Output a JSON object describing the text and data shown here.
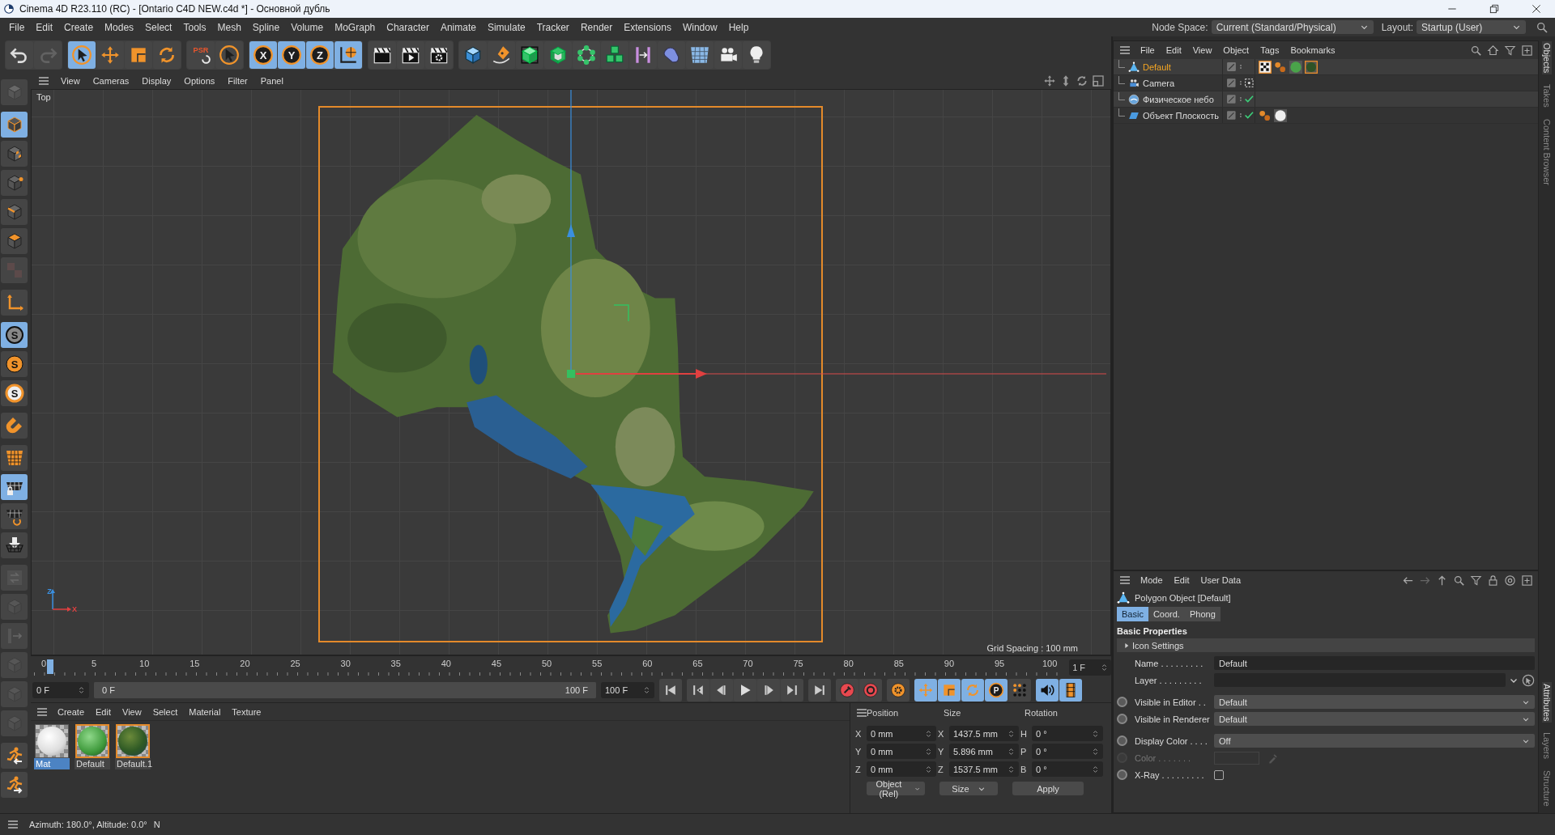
{
  "window": {
    "title": "Cinema 4D R23.110 (RC) - [Ontario C4D NEW.c4d *] - Основной дубль"
  },
  "menu_bar": [
    "File",
    "Edit",
    "Create",
    "Modes",
    "Select",
    "Tools",
    "Mesh",
    "Spline",
    "Volume",
    "MoGraph",
    "Character",
    "Animate",
    "Simulate",
    "Tracker",
    "Render",
    "Extensions",
    "Window",
    "Help"
  ],
  "node_space": {
    "label": "Node Space:",
    "value": "Current (Standard/Physical)"
  },
  "layout": {
    "label": "Layout:",
    "value": "Startup (User)"
  },
  "toolbar": [
    [
      {
        "kind": "undo-arrow",
        "selected": false,
        "disabled": false
      },
      {
        "kind": "redo-arrow",
        "selected": false,
        "disabled": true
      }
    ],
    [
      {
        "kind": "cursor-ring",
        "selected": true,
        "disabled": false
      },
      {
        "kind": "four-arrows",
        "selected": false,
        "disabled": false
      },
      {
        "kind": "scale-square",
        "selected": false,
        "disabled": false
      },
      {
        "kind": "rotate-arrows",
        "selected": false,
        "disabled": false
      }
    ],
    [
      {
        "kind": "psr-letters",
        "glyph": "PSR",
        "selected": false,
        "disabled": false
      },
      {
        "kind": "cursor-ring",
        "selected": false,
        "disabled": false
      }
    ],
    [
      {
        "kind": "axis-letter",
        "glyph": "X",
        "selected": true,
        "disabled": false
      },
      {
        "kind": "axis-letter",
        "glyph": "Y",
        "selected": true,
        "disabled": false
      },
      {
        "kind": "axis-letter",
        "glyph": "Z",
        "selected": true,
        "disabled": false
      },
      {
        "kind": "world-axes",
        "selected": true,
        "disabled": false
      }
    ],
    [
      {
        "kind": "clapper",
        "selected": false,
        "disabled": false
      },
      {
        "kind": "clapper-play",
        "selected": false,
        "disabled": false
      },
      {
        "kind": "clapper-gear",
        "selected": false,
        "disabled": false
      }
    ],
    [
      {
        "kind": "cube-primitive",
        "selected": false,
        "disabled": false
      },
      {
        "kind": "pen-nib",
        "selected": false,
        "disabled": false
      },
      {
        "kind": "subdivision-cube",
        "selected": false,
        "disabled": false
      },
      {
        "kind": "extrude-cube",
        "selected": false,
        "disabled": false
      },
      {
        "kind": "cloner-network",
        "selected": false,
        "disabled": false
      },
      {
        "kind": "stacked-boxes",
        "selected": false,
        "disabled": false
      },
      {
        "kind": "symmetry-bars",
        "selected": false,
        "disabled": false
      },
      {
        "kind": "deformer-capsule",
        "selected": false,
        "disabled": false
      },
      {
        "kind": "floor-grid",
        "selected": false,
        "disabled": false
      },
      {
        "kind": "camera",
        "selected": false,
        "disabled": false
      },
      {
        "kind": "bulb",
        "selected": false,
        "disabled": false
      }
    ]
  ],
  "left_toolbar": [
    [
      {
        "kind": "stacked-cubes",
        "selected": false,
        "disabled": true
      }
    ],
    [
      {
        "kind": "model-cube",
        "selected": true,
        "disabled": false
      },
      {
        "kind": "checker-cube",
        "selected": false,
        "disabled": false
      },
      {
        "kind": "point-cube",
        "selected": false,
        "disabled": false
      },
      {
        "kind": "edge-cube",
        "selected": false,
        "disabled": false
      },
      {
        "kind": "polygon-cube",
        "selected": false,
        "disabled": false
      },
      {
        "kind": "uv-squares",
        "selected": false,
        "disabled": true
      }
    ],
    [
      {
        "kind": "axis-corner",
        "selected": false,
        "disabled": false
      }
    ],
    [
      {
        "kind": "snap-circle",
        "glyph": "S",
        "selected": true,
        "disabled": false
      },
      {
        "kind": "snap-disc",
        "glyph": "S",
        "selected": false,
        "disabled": false
      },
      {
        "kind": "snap-target",
        "glyph": "S",
        "selected": false,
        "disabled": false
      }
    ],
    [
      {
        "kind": "magnet",
        "selected": false,
        "disabled": false
      }
    ],
    [
      {
        "kind": "workplane-grid",
        "selected": false,
        "disabled": false
      },
      {
        "kind": "grid-lock",
        "selected": true,
        "disabled": false
      },
      {
        "kind": "grid-rotate",
        "selected": false,
        "disabled": false
      },
      {
        "kind": "floor-arrow",
        "selected": false,
        "disabled": false
      }
    ],
    [
      {
        "kind": "square-arrows",
        "selected": false,
        "disabled": true
      },
      {
        "kind": "plain-cube",
        "selected": false,
        "disabled": true
      },
      {
        "kind": "slide-arrow",
        "selected": false,
        "disabled": true
      },
      {
        "kind": "plain-cube",
        "selected": false,
        "disabled": true
      },
      {
        "kind": "plain-cube",
        "selected": false,
        "disabled": true
      },
      {
        "kind": "plain-cube",
        "selected": false,
        "disabled": true
      }
    ],
    [
      {
        "kind": "running-figure-left",
        "selected": false,
        "disabled": false
      },
      {
        "kind": "running-figure-right",
        "selected": false,
        "disabled": false
      }
    ]
  ],
  "viewport": {
    "menu": [
      "View",
      "Cameras",
      "Display",
      "Options",
      "Filter",
      "Panel"
    ],
    "camera": "Top",
    "grid_spacing": "Grid Spacing : 100 mm",
    "axis_labels": [
      "Z",
      "X"
    ],
    "picture": {
      "kind": "picture"
    }
  },
  "timeline": {
    "ticks": [
      "0",
      "5",
      "10",
      "15",
      "20",
      "25",
      "30",
      "35",
      "40",
      "45",
      "50",
      "55",
      "60",
      "65",
      "70",
      "75",
      "80",
      "85",
      "90",
      "95",
      "100"
    ],
    "playhead": {
      "level": 0
    },
    "current_frame": "1 F",
    "start_field": "0 F",
    "range": {
      "level": 1
    },
    "range_start": "0 F",
    "range_end": "100 F",
    "end_field": "100 F",
    "transport": [
      {
        "kind": "skip-start"
      },
      {
        "kind": "prev-key"
      },
      {
        "kind": "prev-frame"
      },
      {
        "kind": "play"
      },
      {
        "kind": "next-frame"
      },
      {
        "kind": "next-key"
      },
      {
        "kind": "skip-end"
      }
    ],
    "record": [
      {
        "kind": "record-key",
        "selected": false
      },
      {
        "kind": "autokey",
        "selected": false
      }
    ],
    "keys": [
      {
        "kind": "gear-circle",
        "selected": false
      },
      {
        "kind": "four-arrows",
        "selected": true
      },
      {
        "kind": "scale-square",
        "selected": true
      },
      {
        "kind": "rotate-arrows",
        "selected": true
      },
      {
        "kind": "param-ring",
        "glyph": "P",
        "selected": true
      },
      {
        "kind": "dot-grid",
        "selected": false
      }
    ],
    "extra": [
      {
        "kind": "speaker",
        "selected": true
      },
      {
        "kind": "film-strip",
        "selected": true
      }
    ]
  },
  "materials": {
    "menu": [
      "Create",
      "Edit",
      "View",
      "Select",
      "Material",
      "Texture"
    ],
    "items": [
      {
        "name": "Mat",
        "kind": "white",
        "selected": true,
        "outlined": false
      },
      {
        "name": "Default",
        "kind": "green",
        "selected": false,
        "outlined": true
      },
      {
        "name": "Default.1",
        "kind": "dark-green",
        "selected": false,
        "outlined": true
      }
    ]
  },
  "coordinates": {
    "headers": [
      "Position",
      "Size",
      "Rotation"
    ],
    "rows": [
      {
        "axes": [
          "X",
          "X",
          "H"
        ],
        "values": [
          "0 mm",
          "1437.5 mm",
          "0 °"
        ]
      },
      {
        "axes": [
          "Y",
          "Y",
          "P"
        ],
        "values": [
          "0 mm",
          "5.896 mm",
          "0 °"
        ]
      },
      {
        "axes": [
          "Z",
          "Z",
          "B"
        ],
        "values": [
          "0 mm",
          "1537.5 mm",
          "0 °"
        ]
      }
    ],
    "mode": "Object (Rel)",
    "size_mode": "Size",
    "apply": "Apply"
  },
  "objects": {
    "menu": [
      "File",
      "Edit",
      "View",
      "Object",
      "Tags",
      "Bookmarks"
    ],
    "rows": [
      {
        "name": "Default",
        "kind": "polygon",
        "selected": true,
        "tags": [
          {
            "kind": "checker"
          },
          {
            "kind": "dots"
          },
          {
            "kind": "sphere"
          },
          {
            "kind": "framed-sphere"
          }
        ]
      },
      {
        "name": "Camera",
        "kind": "camera",
        "selected": false,
        "flag": {
          "kind": "target"
        }
      },
      {
        "name": "Физическое небо",
        "kind": "sky",
        "selected": false,
        "flag": {
          "kind": "check"
        }
      },
      {
        "name": "Объект Плоскость",
        "kind": "plane",
        "selected": false,
        "flag": {
          "kind": "check"
        },
        "tags": [
          {
            "kind": "dots"
          },
          {
            "kind": "plain-sphere"
          }
        ]
      }
    ]
  },
  "side_tabs_top": [
    {
      "label": "Objects",
      "selected": true
    },
    {
      "label": "Takes",
      "selected": false
    },
    {
      "label": "Content Browser",
      "selected": false
    }
  ],
  "side_tabs_bottom": [
    {
      "label": "Attributes",
      "selected": true
    },
    {
      "label": "Layers",
      "selected": false
    },
    {
      "label": "Structure",
      "selected": false
    }
  ],
  "attributes": {
    "menu": [
      "Mode",
      "Edit",
      "User Data"
    ],
    "title": "Polygon Object [Default]",
    "tabs": [
      {
        "label": "Basic",
        "selected": true
      },
      {
        "label": "Coord.",
        "selected": false
      },
      {
        "label": "Phong",
        "selected": false
      }
    ],
    "section": "Basic Properties",
    "group": {
      "label": "Icon Settings",
      "expanded": false
    },
    "fields": [
      {
        "kind": "text",
        "label": "Name . . . . . . . . .",
        "value": "Default",
        "animatable": false,
        "disabled": false
      },
      {
        "kind": "link",
        "label": "Layer . . . . . . . . .",
        "animatable": false,
        "disabled": false
      },
      {
        "kind": "dropdown",
        "label": "Visible in Editor . .",
        "value": "Default",
        "animatable": true,
        "disabled": false
      },
      {
        "kind": "dropdown",
        "label": "Visible in Renderer",
        "value": "Default",
        "animatable": true,
        "disabled": false
      },
      {
        "kind": "dropdown",
        "label": "Display Color . . . .",
        "value": "Off",
        "animatable": true,
        "disabled": false
      },
      {
        "kind": "color",
        "label": "Color . . . . . . .",
        "animatable": true,
        "disabled": true
      },
      {
        "kind": "checkbox",
        "label": "X-Ray . . . . . . . . .",
        "checked": false,
        "animatable": true,
        "disabled": false
      }
    ]
  },
  "status_bar": {
    "text": "Azimuth: 180.0°, Altitude: 0.0°",
    "mode": "N"
  }
}
